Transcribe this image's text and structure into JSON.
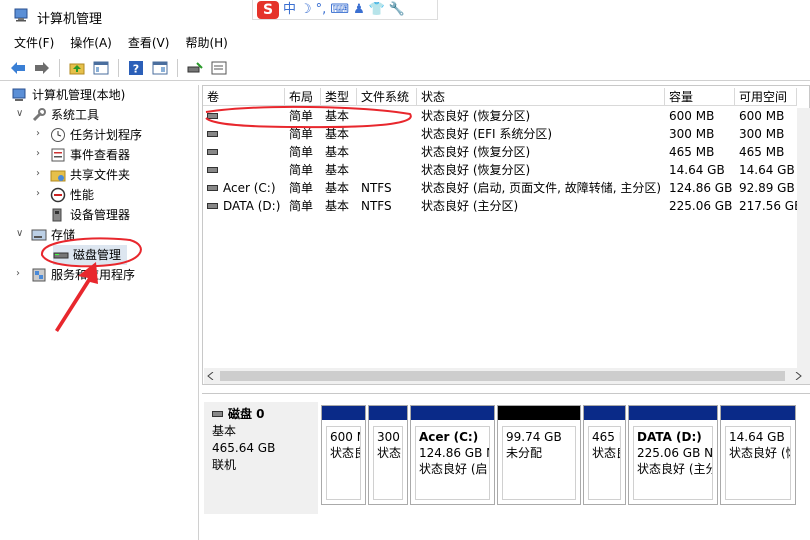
{
  "window": {
    "title": "计算机管理"
  },
  "ime": {
    "logo": "S",
    "items": [
      "中",
      "☽",
      "°,",
      "⌨",
      "♟",
      "👕",
      "🔧"
    ]
  },
  "menu": [
    {
      "label": "文件(F)"
    },
    {
      "label": "操作(A)"
    },
    {
      "label": "查看(V)"
    },
    {
      "label": "帮助(H)"
    }
  ],
  "tree": {
    "root": "计算机管理(本地)",
    "system_tools": "系统工具",
    "task_scheduler": "任务计划程序",
    "event_viewer": "事件查看器",
    "shared_folders": "共享文件夹",
    "performance": "性能",
    "device_manager": "设备管理器",
    "storage": "存储",
    "disk_management": "磁盘管理",
    "services_apps": "服务和应用程序"
  },
  "columns": [
    "卷",
    "布局",
    "类型",
    "文件系统",
    "状态",
    "容量",
    "可用空间"
  ],
  "volumes": [
    {
      "name": "",
      "layout": "简单",
      "type": "基本",
      "fs": "",
      "status": "状态良好 (恢复分区)",
      "capacity": "600 MB",
      "free": "600 MB"
    },
    {
      "name": "",
      "layout": "简单",
      "type": "基本",
      "fs": "",
      "status": "状态良好 (EFI 系统分区)",
      "capacity": "300 MB",
      "free": "300 MB"
    },
    {
      "name": "",
      "layout": "简单",
      "type": "基本",
      "fs": "",
      "status": "状态良好 (恢复分区)",
      "capacity": "465 MB",
      "free": "465 MB"
    },
    {
      "name": "",
      "layout": "简单",
      "type": "基本",
      "fs": "",
      "status": "状态良好 (恢复分区)",
      "capacity": "14.64 GB",
      "free": "14.64 GB"
    },
    {
      "name": "Acer (C:)",
      "layout": "简单",
      "type": "基本",
      "fs": "NTFS",
      "status": "状态良好 (启动, 页面文件, 故障转储, 主分区)",
      "capacity": "124.86 GB",
      "free": "92.89 GB"
    },
    {
      "name": "DATA (D:)",
      "layout": "简单",
      "type": "基本",
      "fs": "NTFS",
      "status": "状态良好 (主分区)",
      "capacity": "225.06 GB",
      "free": "217.56 GE"
    }
  ],
  "disk": {
    "name": "磁盘 0",
    "type": "基本",
    "size": "465.64 GB",
    "state": "联机"
  },
  "partitions": [
    {
      "title": "",
      "line1": "600 M",
      "line2": "状态良",
      "bar": "blue"
    },
    {
      "title": "",
      "line1": "300",
      "line2": "状态良",
      "bar": "blue"
    },
    {
      "title": "Acer  (C:)",
      "line1": "124.86 GB N",
      "line2": "状态良好 (启",
      "bar": "blue"
    },
    {
      "title": "",
      "line1": "99.74 GB",
      "line2": "未分配",
      "bar": "black"
    },
    {
      "title": "",
      "line1": "465 I",
      "line2": "状态良",
      "bar": "blue"
    },
    {
      "title": "DATA  (D:)",
      "line1": "225.06 GB N",
      "line2": "状态良好 (主分",
      "bar": "blue"
    },
    {
      "title": "",
      "line1": "14.64 GB",
      "line2": "状态良好 (恢",
      "bar": "blue"
    }
  ],
  "colors": {
    "partition_blue": "#0a2a88",
    "annotation_red": "#e8272d"
  }
}
